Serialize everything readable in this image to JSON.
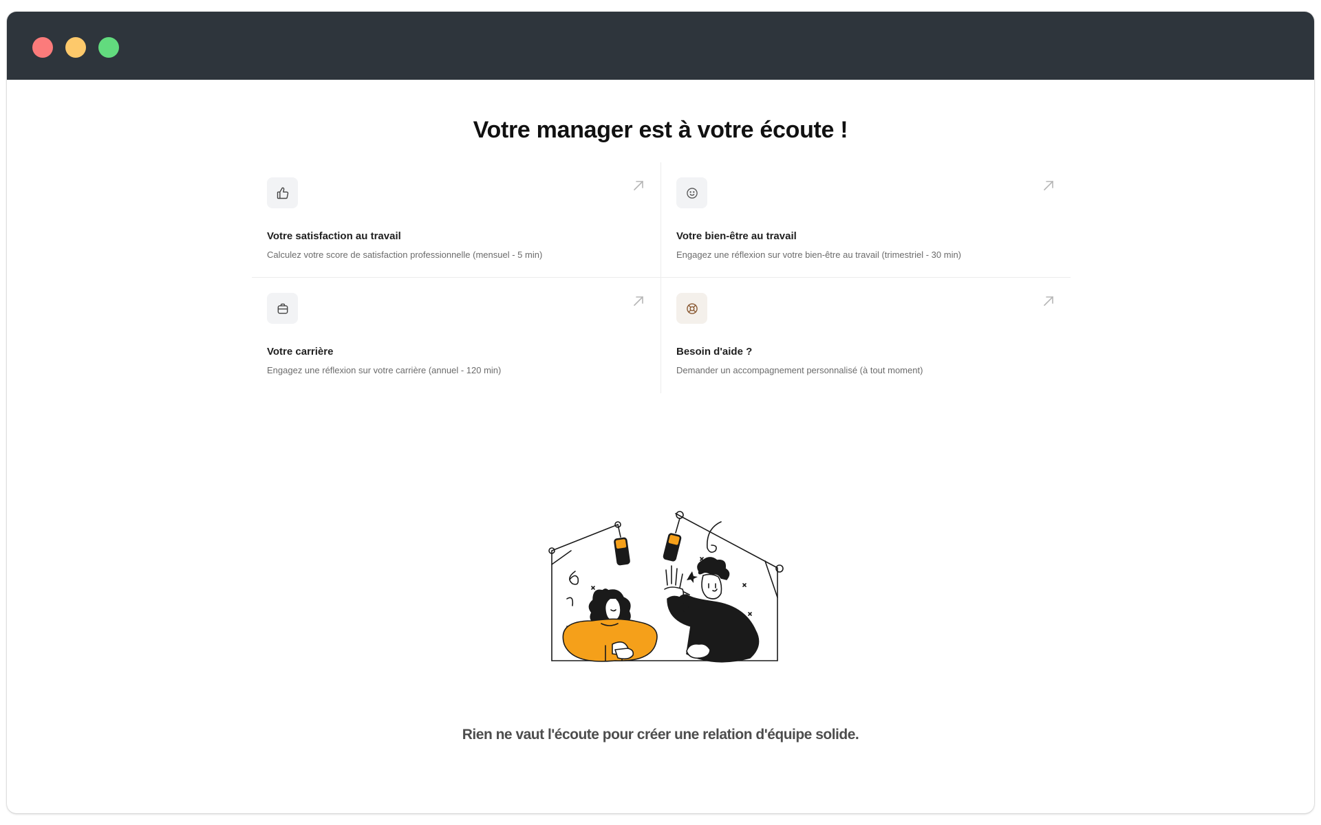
{
  "window": {
    "controls": [
      "close",
      "minimize",
      "zoom"
    ],
    "colors": {
      "titlebar": "#2e353c",
      "close": "#fc7b7b",
      "minimize": "#fdc96b",
      "zoom": "#62db7e"
    }
  },
  "main": {
    "title": "Votre manager est à votre écoute !",
    "cards": [
      {
        "icon": "thumbs-up-icon",
        "title": "Votre satisfaction au travail",
        "description": "Calculez votre score de satisfaction professionnelle (mensuel - 5 min)"
      },
      {
        "icon": "smiley-icon",
        "title": "Votre bien-être au travail",
        "description": "Engagez une réflexion sur votre bien-être au travail (trimestriel - 30 min)"
      },
      {
        "icon": "briefcase-icon",
        "title": "Votre carrière",
        "description": "Engagez une réflexion sur votre carrière (annuel - 120 min)"
      },
      {
        "icon": "lifebuoy-icon",
        "title": "Besoin d'aide ?",
        "description": "Demander un accompagnement personnalisé (à tout moment)"
      }
    ],
    "tagline": "Rien ne vaut l'écoute pour créer une relation d'équipe solide."
  },
  "colors": {
    "accent_orange": "#f5a01a",
    "text_dark": "#111111",
    "text_muted": "#6b6b6b"
  }
}
